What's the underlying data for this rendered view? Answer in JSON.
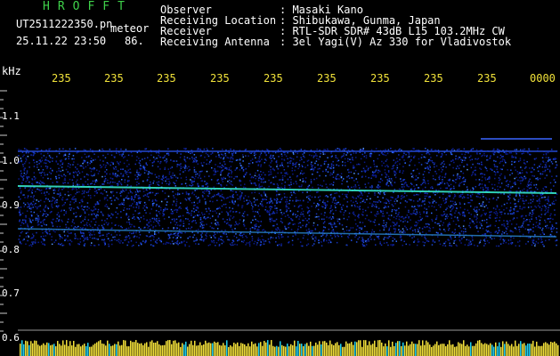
{
  "header": {
    "title": "HROFFT",
    "filename": "UT2511222350.pn",
    "filename_suffix": "meteor",
    "datetime": "25.11.22 23:50",
    "index": "86.",
    "info": [
      {
        "label": "Observer",
        "value": ": Masaki Kano"
      },
      {
        "label": "Receiving Location",
        "value": ": Shibukawa, Gunma, Japan"
      },
      {
        "label": "Receiver",
        "value": ": RTL-SDR SDR# 43dB L15 103.2MHz CW"
      },
      {
        "label": "Receiving Antenna",
        "value": ": 3el Yagi(V) Az 330 for Vladivostok"
      }
    ]
  },
  "axis": {
    "unit": "kHz",
    "time_ticks": [
      "235",
      "235",
      "235",
      "235",
      "235",
      "235",
      "235",
      "235",
      "235",
      "0000"
    ],
    "freq_ticks": [
      "1.1",
      "1.0",
      "0.9",
      "0.8",
      "0.7",
      "0.6"
    ]
  },
  "colors": {
    "background": "#000000",
    "title": "#3fd14a",
    "text": "#ffffff",
    "ticks": "#f1e23a",
    "noise_low": "#0a1a8c",
    "noise_high": "#2f6cff",
    "signal": "#35e6c8",
    "bottom_bar_yellow": "#f3e13a",
    "bottom_bar_cyan": "#20d0f0"
  }
}
